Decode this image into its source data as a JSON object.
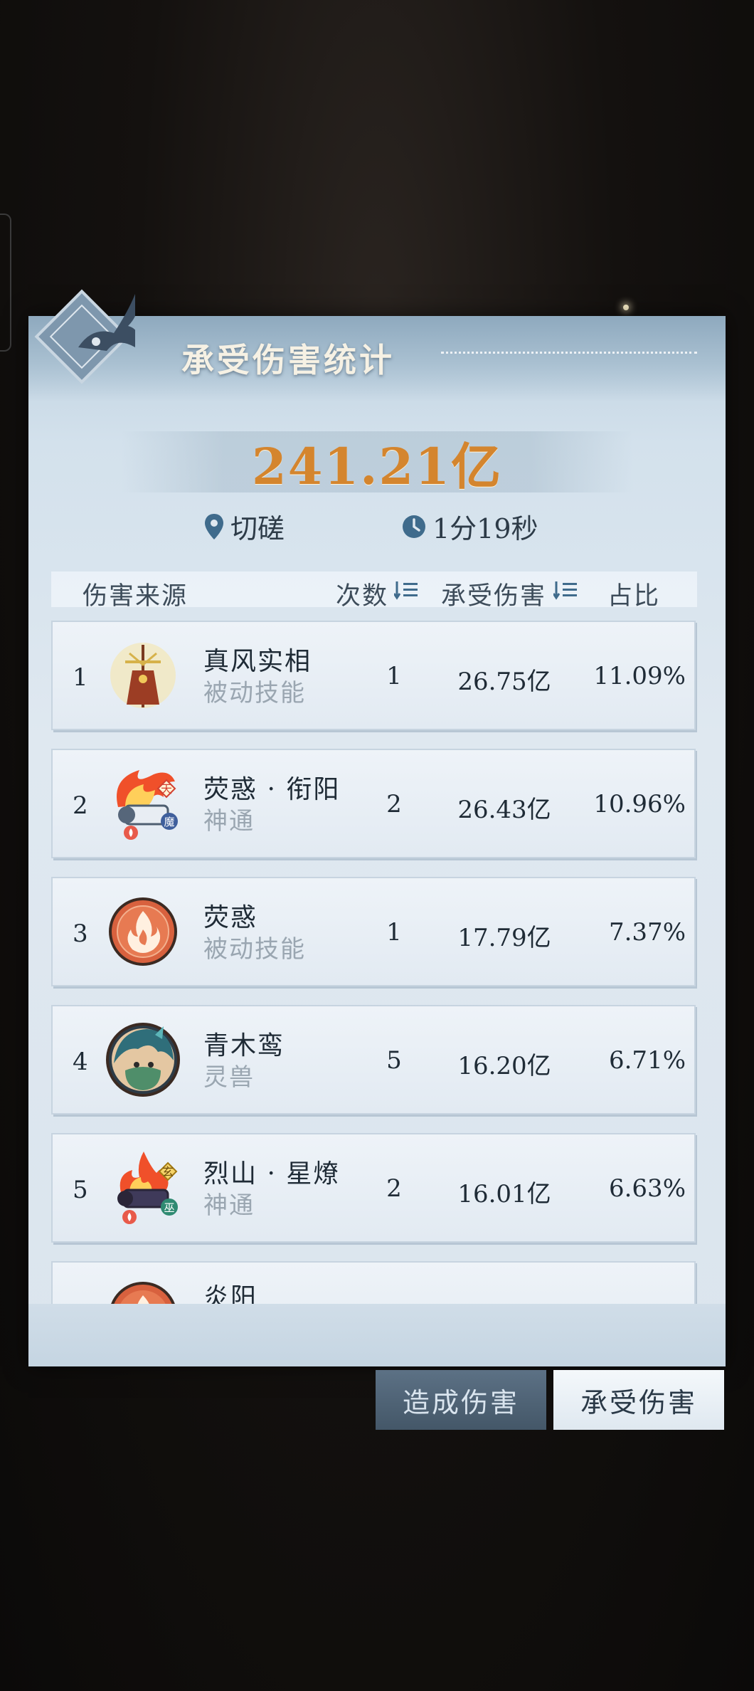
{
  "panel": {
    "title": "承受伤害统计",
    "total_damage": "241.21亿",
    "location": "切磋",
    "duration": "1分19秒"
  },
  "columns": {
    "source": "伤害来源",
    "count": "次数",
    "damage": "承受伤害",
    "ratio": "占比"
  },
  "rows": [
    {
      "rank": "1",
      "name": "真风实相",
      "type": "被动技能",
      "count": "1",
      "damage": "26.75亿",
      "ratio": "11.09%",
      "icon": "totem-icon"
    },
    {
      "rank": "2",
      "name": "荧惑 · 衔阳",
      "type": "神通",
      "count": "2",
      "damage": "26.43亿",
      "ratio": "10.96%",
      "icon": "fire-scroll-icon",
      "badge_top": "天",
      "badge_bottom": "魔"
    },
    {
      "rank": "3",
      "name": "荧惑",
      "type": "被动技能",
      "count": "1",
      "damage": "17.79亿",
      "ratio": "7.37%",
      "icon": "flame-circle-icon"
    },
    {
      "rank": "4",
      "name": "青木鸾",
      "type": "灵兽",
      "count": "5",
      "damage": "16.20亿",
      "ratio": "6.71%",
      "icon": "spirit-beast-avatar"
    },
    {
      "rank": "5",
      "name": "烈山 · 星燎",
      "type": "神通",
      "count": "2",
      "damage": "16.01亿",
      "ratio": "6.63%",
      "icon": "fire-scroll-icon",
      "badge_top": "玄",
      "badge_bottom": "巫"
    },
    {
      "rank": "",
      "name": "炎阳",
      "type": "",
      "count": "",
      "damage": "",
      "ratio": "",
      "icon": "flame-circle-icon"
    }
  ],
  "tabs": {
    "dealt": "造成伤害",
    "taken": "承受伤害",
    "active": "taken"
  },
  "colors": {
    "total": "#d4852e",
    "panel": "#dfe8f0",
    "tab_inactive": "#445768"
  }
}
